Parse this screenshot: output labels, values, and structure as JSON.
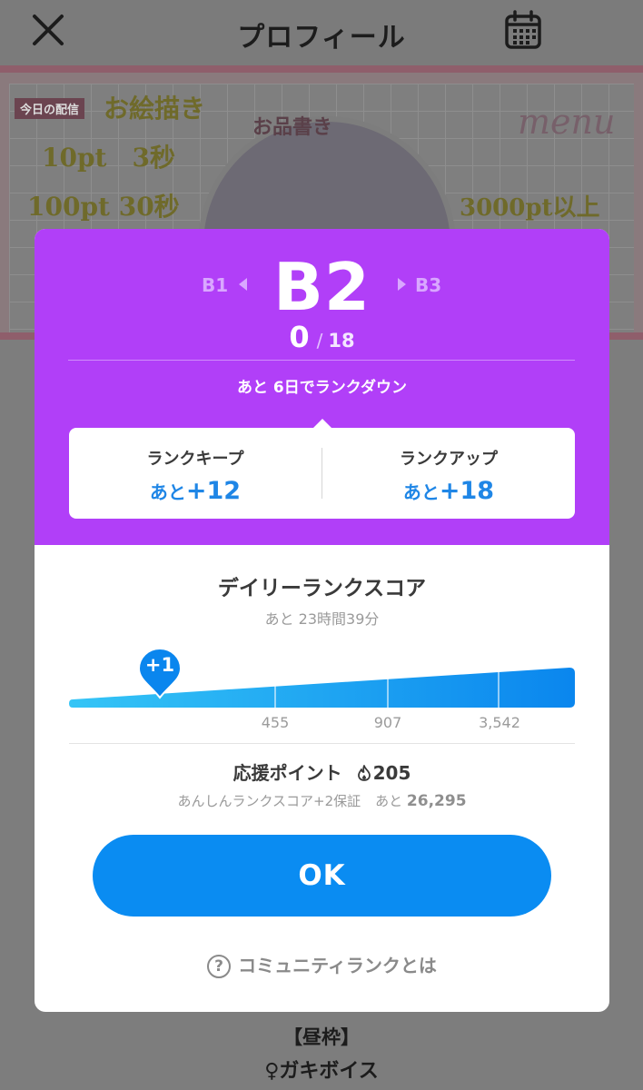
{
  "header": {
    "title": "プロフィール"
  },
  "banner": {
    "tag": "今日の配信",
    "lines": [
      "お絵描き",
      "10pt　3秒",
      "100pt 30秒",
      "3000pt以上"
    ],
    "circle_title": "お品書き",
    "menu_text": "menu"
  },
  "rank": {
    "previous": "B1",
    "current": "B2",
    "next": "B3",
    "progress_current": "0",
    "progress_separator": "/",
    "progress_total": "18",
    "rank_down_notice": "あと 6日でランクダウン",
    "keep_label": "ランクキープ",
    "keep_prefix": "あと",
    "keep_value": "+12",
    "up_label": "ランクアップ",
    "up_prefix": "あと",
    "up_value": "+18"
  },
  "daily_score": {
    "title": "デイリーランクスコア",
    "time_remaining": "あと 23時間39分",
    "current_marker": "+1",
    "ticks": [
      "455",
      "907",
      "3,542"
    ]
  },
  "support": {
    "label": "応援ポイント",
    "points": "205",
    "guarantee_text": "あんしんランクスコア+2保証",
    "remaining_prefix": "あと",
    "remaining_value": "26,295"
  },
  "modal_buttons": {
    "ok_label": "OK",
    "help_label": "コミュニティランクとは",
    "help_icon_glyph": "?"
  },
  "background_text": {
    "slot": "【昼枠】",
    "name": "♀ガキボイス"
  },
  "colors": {
    "rank_purple": "#b13ff8",
    "accent_blue": "#0a8cf2",
    "value_blue": "#1f86e6",
    "bar_gradient_start": "#35c5f6",
    "bar_gradient_end": "#0a86ee"
  },
  "icons": {
    "close": "close-icon",
    "calendar": "calendar-icon",
    "flame": "flame-icon",
    "help": "help-icon"
  }
}
